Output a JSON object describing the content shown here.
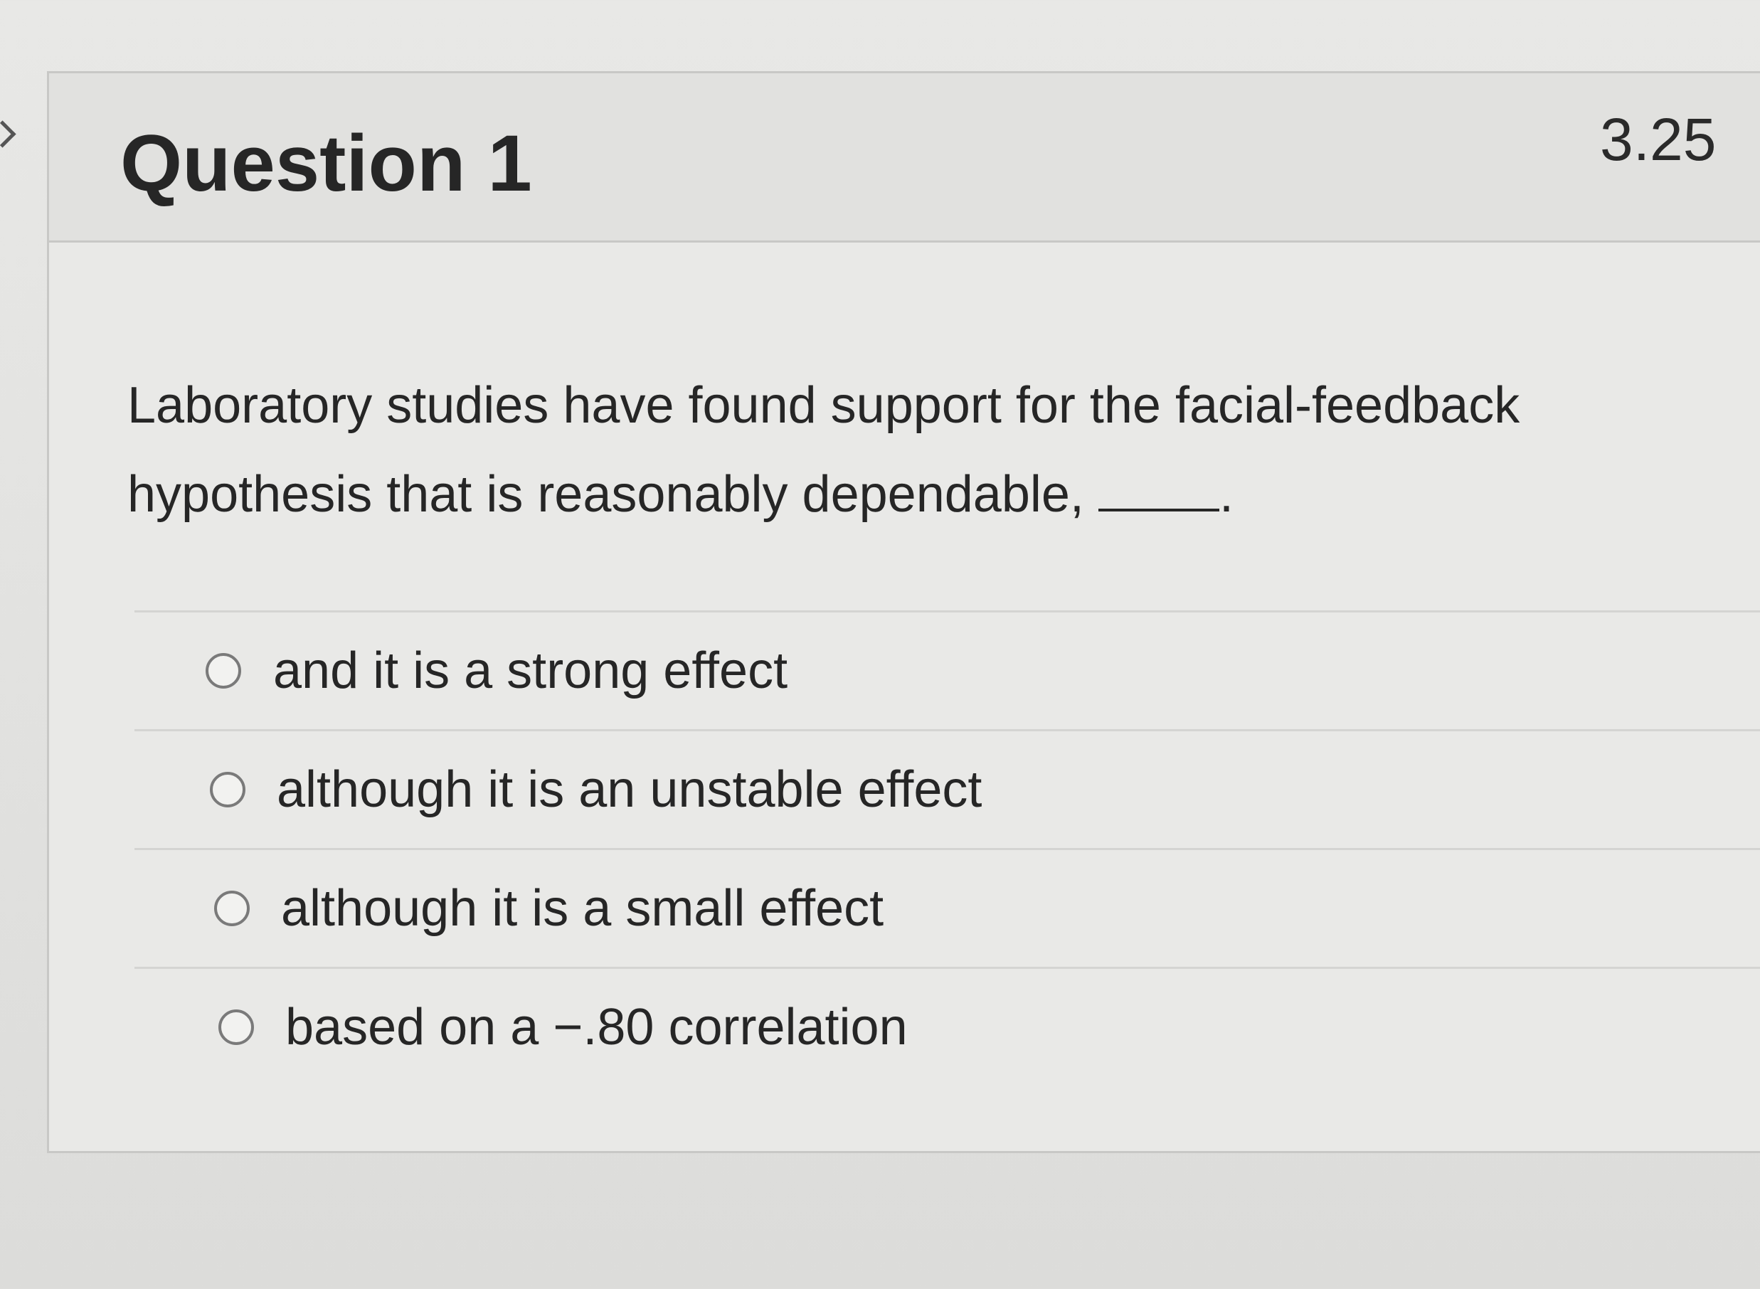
{
  "question": {
    "title": "Question 1",
    "points": "3.25",
    "prompt": "Laboratory studies have found support for the facial-feedback hypothesis that is reasonably dependable,",
    "prompt_end": "."
  },
  "options": [
    {
      "label": "and it is a strong effect",
      "selected": false
    },
    {
      "label": "although it is an unstable effect",
      "selected": false
    },
    {
      "label": "although it is a small effect",
      "selected": false
    },
    {
      "label": "based on a −.80 correlation",
      "selected": false
    }
  ],
  "icons": {
    "expand": "chevron-right-icon",
    "option_marker": "radio-button-icon"
  },
  "colors": {
    "background": "#e2e2e0",
    "header": "#e1e1df",
    "text": "#262626",
    "border": "#c8c8c6"
  }
}
